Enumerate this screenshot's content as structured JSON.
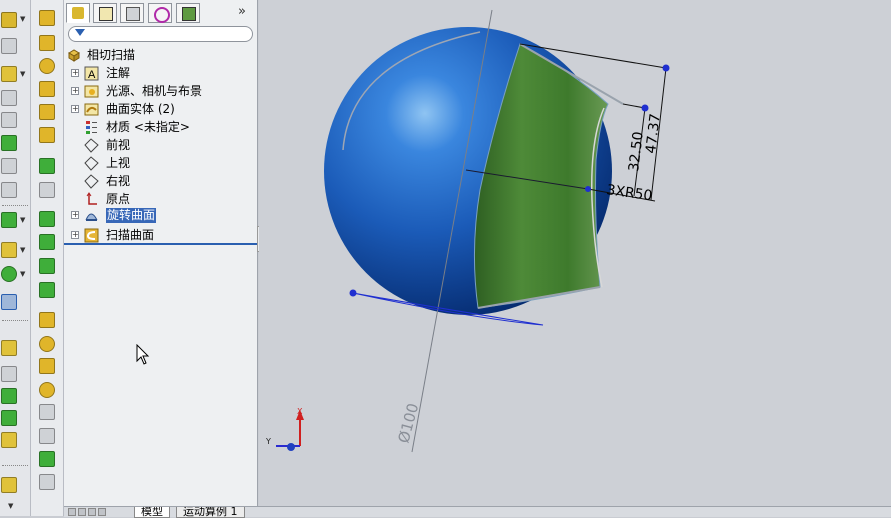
{
  "feature_tree": {
    "tabs": [
      "feature-manager",
      "property-manager",
      "configuration-manager",
      "dimxpert-manager",
      "display-manager"
    ],
    "root": "相切扫描",
    "items": [
      {
        "label": "注解",
        "icon": "annotations-icon",
        "expandable": true
      },
      {
        "label": "光源、相机与布景",
        "icon": "lights-cameras-icon",
        "expandable": true
      },
      {
        "label": "曲面实体 (2)",
        "icon": "surface-bodies-icon",
        "expandable": true
      },
      {
        "label": "材质 <未指定>",
        "icon": "material-icon",
        "expandable": false
      },
      {
        "label": "前视",
        "icon": "plane-icon",
        "expandable": false
      },
      {
        "label": "上视",
        "icon": "plane-icon",
        "expandable": false
      },
      {
        "label": "右视",
        "icon": "plane-icon",
        "expandable": false
      },
      {
        "label": "原点",
        "icon": "origin-icon",
        "expandable": false
      },
      {
        "label": "旋转曲面",
        "icon": "revolve-surface-icon",
        "expandable": true,
        "selected": true
      },
      {
        "label": "扫描曲面",
        "icon": "sweep-surface-icon",
        "expandable": true
      }
    ]
  },
  "bottom_tabs": [
    "模型",
    "运动算例 1"
  ],
  "graphics": {
    "dimensions": [
      "32.50",
      "47.37",
      "3XR50",
      "Ø100"
    ],
    "triad": {
      "x": "X",
      "y": "Y"
    }
  },
  "colors": {
    "sphere": "#1b5bb8",
    "sweep_surface": "#3b7a2e",
    "selection": "#2a5fb0",
    "background": "#cdd0d6"
  }
}
